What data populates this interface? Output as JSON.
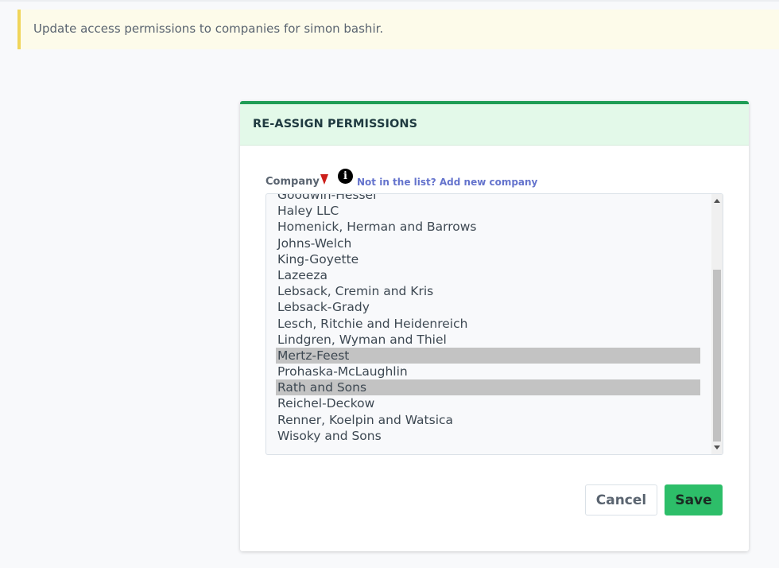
{
  "alert": {
    "message": "Update access permissions to companies for simon bashir."
  },
  "card": {
    "title": "RE-ASSIGN PERMISSIONS"
  },
  "form": {
    "company_label": "Company",
    "info_icon": "info-icon",
    "add_company_link": "Not in the list? Add new company",
    "required_marker_color": "#cc1f1a",
    "companies": [
      {
        "name": "Goodwin-Hessel",
        "selected": false
      },
      {
        "name": "Haley LLC",
        "selected": false
      },
      {
        "name": "Homenick, Herman and Barrows",
        "selected": false
      },
      {
        "name": "Johns-Welch",
        "selected": false
      },
      {
        "name": "King-Goyette",
        "selected": false
      },
      {
        "name": "Lazeeza",
        "selected": false
      },
      {
        "name": "Lebsack, Cremin and Kris",
        "selected": false
      },
      {
        "name": "Lebsack-Grady",
        "selected": false
      },
      {
        "name": "Lesch, Ritchie and Heidenreich",
        "selected": false
      },
      {
        "name": "Lindgren, Wyman and Thiel",
        "selected": false
      },
      {
        "name": "Mertz-Feest",
        "selected": true
      },
      {
        "name": "Prohaska-McLaughlin",
        "selected": false
      },
      {
        "name": "Rath and Sons",
        "selected": true
      },
      {
        "name": "Reichel-Deckow",
        "selected": false
      },
      {
        "name": "Renner, Koelpin and Watsica",
        "selected": false
      },
      {
        "name": "Wisoky and Sons",
        "selected": false
      }
    ]
  },
  "buttons": {
    "cancel_label": "Cancel",
    "save_label": "Save"
  },
  "colors": {
    "alert_border": "#f0d55a",
    "card_accent": "#1f9d55",
    "header_bg": "#e3f9e9",
    "link": "#6574cd",
    "save_button": "#2dbe69",
    "selected_option": "#c3c3c3"
  }
}
